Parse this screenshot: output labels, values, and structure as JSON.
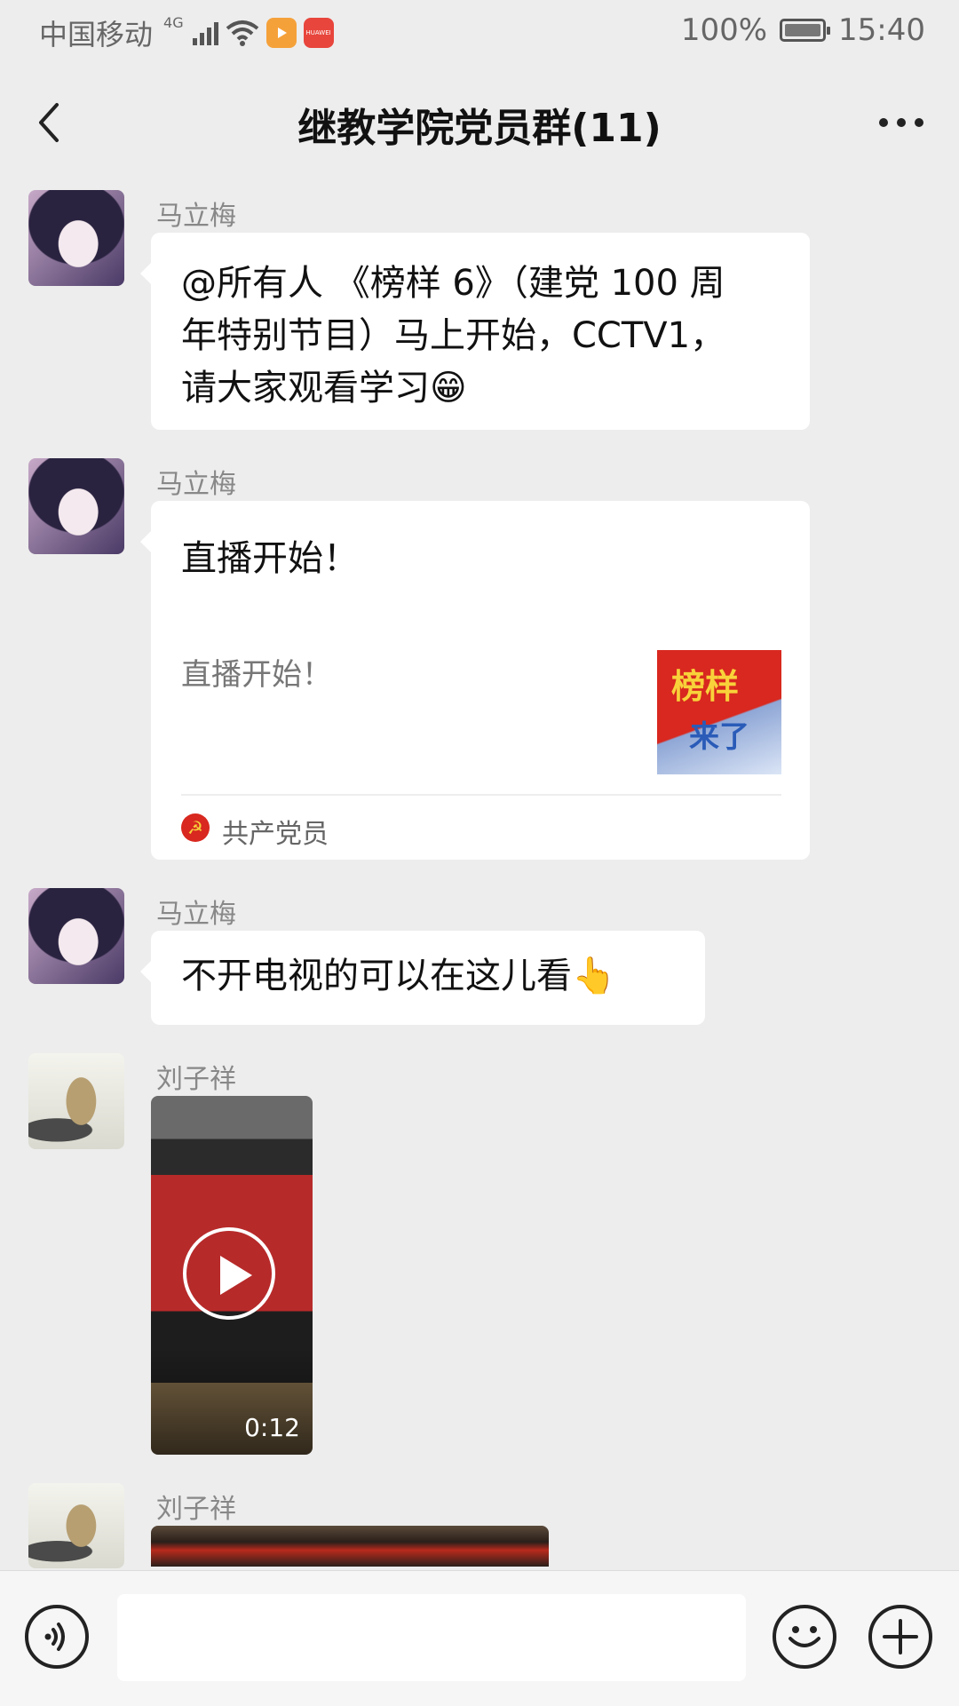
{
  "status_bar": {
    "carrier": "中国移动",
    "network": "4G",
    "app_badge_label": "HUAWEI",
    "battery_percent": "100%",
    "battery_level": 1.0,
    "time": "15:40"
  },
  "header": {
    "title": "继教学院党员群(11)"
  },
  "messages": [
    {
      "sender": "马立梅",
      "avatar": "woman-photo",
      "text_lines": [
        "@所有人 《榜样 6》（建党 100 周",
        "年特别节目）马上开始，CCTV1，",
        "请大家观看学习😁"
      ]
    },
    {
      "sender": "马立梅",
      "avatar": "woman-photo",
      "card": {
        "title": "直播开始！",
        "description": "直播开始！",
        "thumbnail_text_1": "榜样",
        "thumbnail_text_2": "来了",
        "source": "共产党员",
        "source_icon": "☭"
      }
    },
    {
      "sender": "马立梅",
      "avatar": "woman-photo",
      "text": "不开电视的可以在这儿看👆"
    },
    {
      "sender": "刘子祥",
      "avatar": "ink-painting",
      "video": {
        "duration": "0:12"
      }
    },
    {
      "sender": "刘子祥",
      "avatar": "ink-painting",
      "video": {}
    }
  ],
  "input_bar": {
    "voice_icon": "voice-icon",
    "emoji_icon": "emoji-icon",
    "plus_icon": "plus-icon",
    "placeholder": ""
  }
}
